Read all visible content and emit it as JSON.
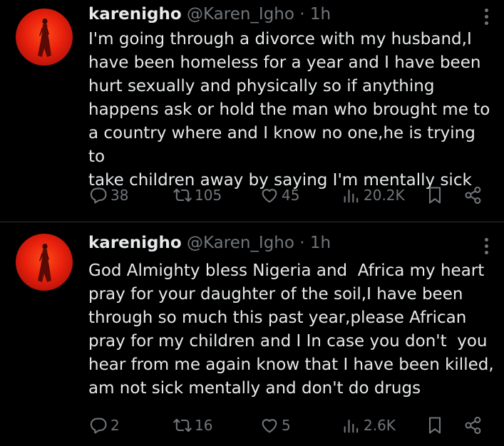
{
  "tweets": [
    {
      "display_name": "karenigho",
      "handle": "@Karen_Igho",
      "separator": "·",
      "time": "1h",
      "text": "I'm going through a divorce with my husband,I\nhave been homeless for a year and I have been\nhurt sexually and physically so if anything\nhappens ask or hold the man who brought me to\na country where and I know no one,he is trying to\ntake children away by saying I'm mentally sick",
      "replies": "38",
      "retweets": "105",
      "likes": "45",
      "views": "20.2K"
    },
    {
      "display_name": "karenigho",
      "handle": "@Karen_Igho",
      "separator": "·",
      "time": "1h",
      "text": "God Almighty bless Nigeria and  Africa my heart\npray for your daughter of the soil,I have been\nthrough so much this past year,please African\npray for my children and I In case you don't  you\nhear from me again know that I have been killed,\nam not sick mentally and don't do drugs",
      "replies": "2",
      "retweets": "16",
      "likes": "5",
      "views": "2.6K"
    }
  ],
  "icons": {
    "reply": "reply-icon",
    "retweet": "retweet-icon",
    "like": "heart-icon",
    "views": "views-icon",
    "bookmark": "bookmark-icon",
    "share": "share-icon",
    "more": "more-icon"
  },
  "colors": {
    "background": "#000000",
    "text": "#e7e9ea",
    "muted": "#71767b",
    "divider": "#2f3336",
    "avatar_red": "#e8200c"
  }
}
